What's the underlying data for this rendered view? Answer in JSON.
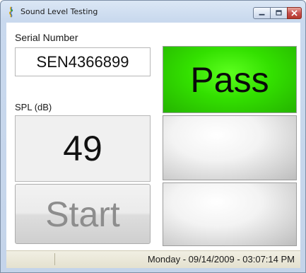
{
  "window": {
    "title": "Sound Level Testing",
    "icon": "app-icon"
  },
  "controls": {
    "minimize": "minimize-icon",
    "maximize": "maximize-icon",
    "close": "close-icon"
  },
  "serial": {
    "label": "Serial Number",
    "value": "SEN4366899"
  },
  "spl": {
    "label": "SPL (dB)",
    "value": "49"
  },
  "start_button": {
    "label": "Start"
  },
  "results": {
    "status_1": "Pass",
    "status_1_color": "#33e000",
    "status_2": "",
    "status_3": ""
  },
  "statusbar": {
    "datetime": "Monday - 09/14/2009 - 03:07:14 PM"
  }
}
